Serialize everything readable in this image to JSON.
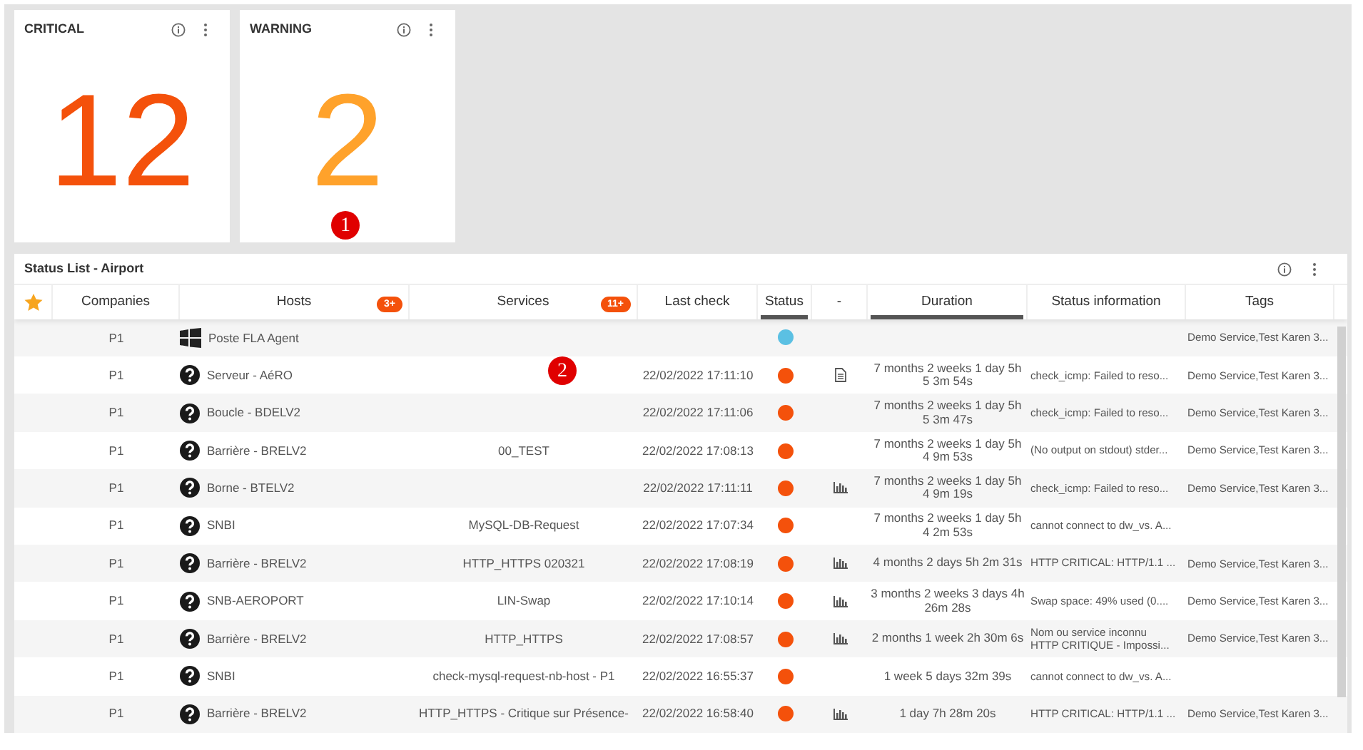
{
  "cards": [
    {
      "title": "CRITICAL",
      "value": "12",
      "color": "#f4510b"
    },
    {
      "title": "WARNING",
      "value": "2",
      "color": "#ffa22b"
    }
  ],
  "status_list": {
    "title": "Status List - Airport",
    "columns": [
      {
        "kind": "star"
      },
      {
        "kind": "text",
        "label": "Companies",
        "sorted": false
      },
      {
        "kind": "text",
        "label": "Hosts",
        "badge": "3+",
        "sorted": false
      },
      {
        "kind": "text",
        "label": "Services",
        "badge": "11+",
        "sorted": false
      },
      {
        "kind": "text",
        "label": "Last check",
        "sorted": false
      },
      {
        "kind": "text",
        "label": "Status",
        "sorted": true
      },
      {
        "kind": "text",
        "label": "-",
        "sorted": false
      },
      {
        "kind": "text",
        "label": "Duration",
        "sorted": true
      },
      {
        "kind": "text",
        "label": "Status information",
        "sorted": false
      },
      {
        "kind": "text",
        "label": "Tags",
        "sorted": false
      }
    ],
    "rows": [
      {
        "company": "P1",
        "host_icon": {
          "kind": "windows"
        },
        "host": "Poste FLA Agent",
        "color": "#5bc0e3",
        "tags": "Demo Service,Test Karen 3..."
      },
      {
        "company": "P1",
        "host_icon": {
          "kind": "unknown"
        },
        "host": "Serveur - AéRO",
        "last_check": "22/02/2022 17:11:10",
        "color": "#f4510b",
        "action": {
          "kind": "document"
        },
        "duration": "7 months 2 weeks 1 day 5h 5 3m 54s",
        "status_info": "check_icmp: Failed to reso...",
        "tags": "Demo Service,Test Karen 3..."
      },
      {
        "company": "P1",
        "host_icon": {
          "kind": "unknown"
        },
        "host": "Boucle - BDELV2",
        "last_check": "22/02/2022 17:11:06",
        "color": "#f4510b",
        "duration": "7 months 2 weeks 1 day 5h 5 3m 47s",
        "status_info": "check_icmp: Failed to reso...",
        "tags": "Demo Service,Test Karen 3..."
      },
      {
        "company": "P1",
        "host_icon": {
          "kind": "unknown"
        },
        "host": "Barrière - BRELV2",
        "service": "00_TEST",
        "last_check": "22/02/2022 17:08:13",
        "color": "#f4510b",
        "duration": "7 months 2 weeks 1 day 5h 4 9m 53s",
        "status_info": "(No output on stdout) stder...",
        "tags": "Demo Service,Test Karen 3..."
      },
      {
        "company": "P1",
        "host_icon": {
          "kind": "unknown"
        },
        "host": "Borne - BTELV2",
        "last_check": "22/02/2022 17:11:11",
        "color": "#f4510b",
        "action": {
          "kind": "chart"
        },
        "duration": "7 months 2 weeks 1 day 5h 4 9m 19s",
        "status_info": "check_icmp: Failed to reso...",
        "tags": "Demo Service,Test Karen 3..."
      },
      {
        "company": "P1",
        "host_icon": {
          "kind": "unknown"
        },
        "host": "SNBI",
        "service": "MySQL-DB-Request",
        "last_check": "22/02/2022 17:07:34",
        "color": "#f4510b",
        "duration": "7 months 2 weeks 1 day 5h 4 2m 53s",
        "status_info": "cannot connect to dw_vs. A..."
      },
      {
        "company": "P1",
        "host_icon": {
          "kind": "unknown"
        },
        "host": "Barrière - BRELV2",
        "service": "HTTP_HTTPS 020321",
        "last_check": "22/02/2022 17:08:19",
        "color": "#f4510b",
        "action": {
          "kind": "chart"
        },
        "duration": "4 months 2 days 5h 2m 31s",
        "status_info": "HTTP CRITICAL: HTTP/1.1 ...",
        "tags": "Demo Service,Test Karen 3..."
      },
      {
        "company": "P1",
        "host_icon": {
          "kind": "unknown"
        },
        "host": "SNB-AEROPORT",
        "service": "LIN-Swap",
        "last_check": "22/02/2022 17:10:14",
        "color": "#f4510b",
        "action": {
          "kind": "chart"
        },
        "duration": "3 months 2 weeks 3 days 4h 26m 28s",
        "status_info": "Swap space: 49% used (0....",
        "tags": "Demo Service,Test Karen 3..."
      },
      {
        "company": "P1",
        "host_icon": {
          "kind": "unknown"
        },
        "host": "Barrière - BRELV2",
        "service": "HTTP_HTTPS",
        "last_check": "22/02/2022 17:08:57",
        "color": "#f4510b",
        "action": {
          "kind": "chart"
        },
        "duration": "2 months 1 week 2h 30m 6s",
        "status_info": "Nom ou service inconnu\nHTTP CRITIQUE - Impossi...",
        "tags": "Demo Service,Test Karen 3..."
      },
      {
        "company": "P1",
        "host_icon": {
          "kind": "unknown"
        },
        "host": "SNBI",
        "service": "check-mysql-request-nb-host - P1",
        "last_check": "22/02/2022 16:55:37",
        "color": "#f4510b",
        "duration": "1 week 5 days 32m 39s",
        "status_info": "cannot connect to dw_vs. A..."
      },
      {
        "company": "P1",
        "host_icon": {
          "kind": "unknown"
        },
        "host": "Barrière - BRELV2",
        "service": "HTTP_HTTPS - Critique sur Présence-",
        "last_check": "22/02/2022 16:58:40",
        "color": "#f4510b",
        "action": {
          "kind": "chart"
        },
        "duration": "1 day 7h 28m 20s",
        "status_info": "HTTP CRITICAL: HTTP/1.1 ...",
        "tags": "Demo Service,Test Karen 3..."
      }
    ]
  },
  "callouts": [
    "1",
    "2"
  ]
}
